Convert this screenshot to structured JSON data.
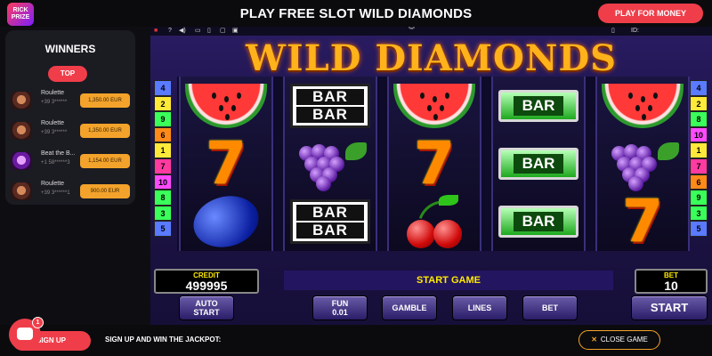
{
  "header": {
    "logo_text": "RICK PRIZE",
    "title": "PLAY FREE SLOT WILD DIAMONDS",
    "play_for_money": "PLAY FOR MONEY"
  },
  "sidebar": {
    "title": "WINNERS",
    "top_button": "TOP",
    "winners": [
      {
        "game": "Roulette",
        "user": "+39 3******",
        "amount": "1,350.00 EUR",
        "avatar": "roulette-avatar"
      },
      {
        "game": "Roulette",
        "user": "+39 3******",
        "amount": "1,350.00 EUR",
        "avatar": "roulette-avatar"
      },
      {
        "game": "Beat the B...",
        "user": "+1 58******3",
        "amount": "1,154.00 EUR",
        "avatar": "beat-the-bank-avatar"
      },
      {
        "game": "Roulette",
        "user": "+39 3******1",
        "amount": "900.00 EUR",
        "avatar": "roulette-avatar"
      }
    ]
  },
  "game": {
    "toolbar": {
      "flag": "uk-flag-icon",
      "help": "?",
      "id_label": "ID:"
    },
    "logo": "WILD DIAMONDS",
    "reels": [
      [
        "watermelon",
        "seven",
        "plum"
      ],
      [
        "bar-bar",
        "grapes",
        "bar-bar"
      ],
      [
        "watermelon",
        "seven",
        "cherry"
      ],
      [
        "green-bar",
        "green-bar",
        "green-bar"
      ],
      [
        "watermelon",
        "grapes",
        "seven"
      ]
    ],
    "paylines_left": [
      {
        "n": "4",
        "color": "#5a7aff"
      },
      {
        "n": "2",
        "color": "#ffea3a"
      },
      {
        "n": "9",
        "color": "#3aff5a"
      },
      {
        "n": "6",
        "color": "#ff8a1a"
      },
      {
        "n": "1",
        "color": "#ffea3a"
      },
      {
        "n": "7",
        "color": "#ff3aa0"
      },
      {
        "n": "10",
        "color": "#ff4aff"
      },
      {
        "n": "8",
        "color": "#3aff5a"
      },
      {
        "n": "3",
        "color": "#3aff5a"
      },
      {
        "n": "5",
        "color": "#5a7aff"
      }
    ],
    "paylines_right": [
      {
        "n": "4",
        "color": "#5a7aff"
      },
      {
        "n": "2",
        "color": "#ffea3a"
      },
      {
        "n": "8",
        "color": "#3aff5a"
      },
      {
        "n": "10",
        "color": "#ff4aff"
      },
      {
        "n": "1",
        "color": "#ffea3a"
      },
      {
        "n": "7",
        "color": "#ff3aa0"
      },
      {
        "n": "6",
        "color": "#ff8a1a"
      },
      {
        "n": "9",
        "color": "#3aff5a"
      },
      {
        "n": "3",
        "color": "#3aff5a"
      },
      {
        "n": "5",
        "color": "#5a7aff"
      }
    ],
    "credit_label": "CREDIT",
    "credit_value": "499995",
    "status": "START GAME",
    "bet_label": "BET",
    "bet_value": "10",
    "buttons": {
      "auto_start_1": "AUTO",
      "auto_start_2": "START",
      "fun_1": "FUN",
      "fun_2": "0.01",
      "gamble": "GAMBLE",
      "lines": "LINES",
      "bet": "BET",
      "start": "START"
    }
  },
  "footer": {
    "signup": "SIGN UP",
    "jackpot": "SIGN UP AND WIN THE JACKPOT:",
    "close_game": "CLOSE GAME",
    "chat_badge": "1"
  }
}
